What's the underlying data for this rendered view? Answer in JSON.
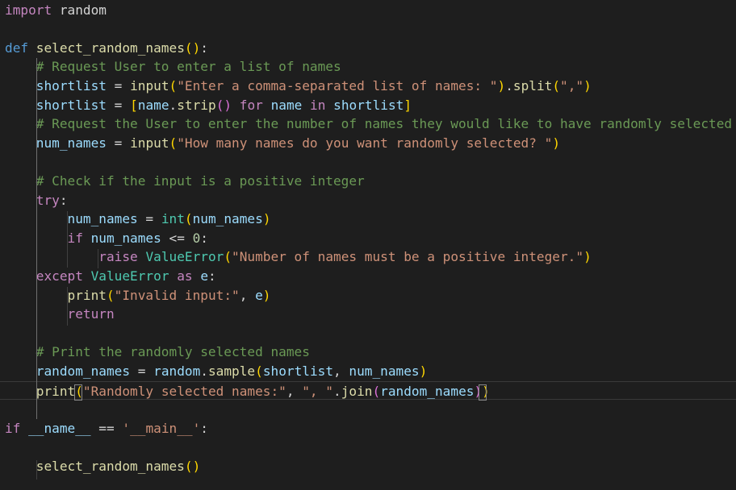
{
  "editor": {
    "language": "python",
    "colors": {
      "background": "#1e1e1e",
      "text": "#d4d4d4",
      "keyword": "#569cd6",
      "control": "#c586c0",
      "function": "#dcdcaa",
      "variable": "#9cdcfe",
      "string": "#ce9178",
      "comment": "#6a9955",
      "number": "#b5cea8",
      "class": "#4ec9b0",
      "bracket_1": "#ffd700",
      "bracket_2": "#da70d6",
      "bracket_3": "#179fff"
    },
    "lines": [
      [
        {
          "t": "import",
          "c": "control"
        },
        {
          "t": " random",
          "c": "text"
        }
      ],
      [],
      [
        {
          "t": "def",
          "c": "keyword"
        },
        {
          "t": " ",
          "c": "text"
        },
        {
          "t": "select_random_names",
          "c": "function"
        },
        {
          "t": "(",
          "c": "bracket_1"
        },
        {
          "t": ")",
          "c": "bracket_1"
        },
        {
          "t": ":",
          "c": "text"
        }
      ],
      [
        {
          "t": "    ",
          "c": "text"
        },
        {
          "t": "# Request User to enter a list of names",
          "c": "comment"
        }
      ],
      [
        {
          "t": "    ",
          "c": "text"
        },
        {
          "t": "shortlist",
          "c": "variable"
        },
        {
          "t": " = ",
          "c": "text"
        },
        {
          "t": "input",
          "c": "function"
        },
        {
          "t": "(",
          "c": "bracket_1"
        },
        {
          "t": "\"Enter a comma-separated list of names: \"",
          "c": "string"
        },
        {
          "t": ")",
          "c": "bracket_1"
        },
        {
          "t": ".",
          "c": "text"
        },
        {
          "t": "split",
          "c": "function"
        },
        {
          "t": "(",
          "c": "bracket_1"
        },
        {
          "t": "\",\"",
          "c": "string"
        },
        {
          "t": ")",
          "c": "bracket_1"
        }
      ],
      [
        {
          "t": "    ",
          "c": "text"
        },
        {
          "t": "shortlist",
          "c": "variable"
        },
        {
          "t": " = ",
          "c": "text"
        },
        {
          "t": "[",
          "c": "bracket_1"
        },
        {
          "t": "name",
          "c": "variable"
        },
        {
          "t": ".",
          "c": "text"
        },
        {
          "t": "strip",
          "c": "function"
        },
        {
          "t": "(",
          "c": "bracket_2"
        },
        {
          "t": ")",
          "c": "bracket_2"
        },
        {
          "t": " ",
          "c": "text"
        },
        {
          "t": "for",
          "c": "control"
        },
        {
          "t": " ",
          "c": "text"
        },
        {
          "t": "name",
          "c": "variable"
        },
        {
          "t": " ",
          "c": "text"
        },
        {
          "t": "in",
          "c": "control"
        },
        {
          "t": " ",
          "c": "text"
        },
        {
          "t": "shortlist",
          "c": "variable"
        },
        {
          "t": "]",
          "c": "bracket_1"
        }
      ],
      [
        {
          "t": "    ",
          "c": "text"
        },
        {
          "t": "# Request the User to enter the number of names they would like to have randomly selected",
          "c": "comment"
        }
      ],
      [
        {
          "t": "    ",
          "c": "text"
        },
        {
          "t": "num_names",
          "c": "variable"
        },
        {
          "t": " = ",
          "c": "text"
        },
        {
          "t": "input",
          "c": "function"
        },
        {
          "t": "(",
          "c": "bracket_1"
        },
        {
          "t": "\"How many names do you want randomly selected? \"",
          "c": "string"
        },
        {
          "t": ")",
          "c": "bracket_1"
        }
      ],
      [],
      [
        {
          "t": "    ",
          "c": "text"
        },
        {
          "t": "# Check if the input is a positive integer",
          "c": "comment"
        }
      ],
      [
        {
          "t": "    ",
          "c": "text"
        },
        {
          "t": "try",
          "c": "control"
        },
        {
          "t": ":",
          "c": "text"
        }
      ],
      [
        {
          "t": "        ",
          "c": "text"
        },
        {
          "t": "num_names",
          "c": "variable"
        },
        {
          "t": " = ",
          "c": "text"
        },
        {
          "t": "int",
          "c": "class"
        },
        {
          "t": "(",
          "c": "bracket_1"
        },
        {
          "t": "num_names",
          "c": "variable"
        },
        {
          "t": ")",
          "c": "bracket_1"
        }
      ],
      [
        {
          "t": "        ",
          "c": "text"
        },
        {
          "t": "if",
          "c": "control"
        },
        {
          "t": " ",
          "c": "text"
        },
        {
          "t": "num_names",
          "c": "variable"
        },
        {
          "t": " <= ",
          "c": "text"
        },
        {
          "t": "0",
          "c": "number"
        },
        {
          "t": ":",
          "c": "text"
        }
      ],
      [
        {
          "t": "            ",
          "c": "text"
        },
        {
          "t": "raise",
          "c": "control"
        },
        {
          "t": " ",
          "c": "text"
        },
        {
          "t": "ValueError",
          "c": "class"
        },
        {
          "t": "(",
          "c": "bracket_1"
        },
        {
          "t": "\"Number of names must be a positive integer.\"",
          "c": "string"
        },
        {
          "t": ")",
          "c": "bracket_1"
        }
      ],
      [
        {
          "t": "    ",
          "c": "text"
        },
        {
          "t": "except",
          "c": "control"
        },
        {
          "t": " ",
          "c": "text"
        },
        {
          "t": "ValueError",
          "c": "class"
        },
        {
          "t": " ",
          "c": "text"
        },
        {
          "t": "as",
          "c": "control"
        },
        {
          "t": " ",
          "c": "text"
        },
        {
          "t": "e",
          "c": "variable"
        },
        {
          "t": ":",
          "c": "text"
        }
      ],
      [
        {
          "t": "        ",
          "c": "text"
        },
        {
          "t": "print",
          "c": "function"
        },
        {
          "t": "(",
          "c": "bracket_1"
        },
        {
          "t": "\"Invalid input:\"",
          "c": "string"
        },
        {
          "t": ", ",
          "c": "text"
        },
        {
          "t": "e",
          "c": "variable"
        },
        {
          "t": ")",
          "c": "bracket_1"
        }
      ],
      [
        {
          "t": "        ",
          "c": "text"
        },
        {
          "t": "return",
          "c": "control"
        }
      ],
      [],
      [
        {
          "t": "    ",
          "c": "text"
        },
        {
          "t": "# Print the randomly selected names",
          "c": "comment"
        }
      ],
      [
        {
          "t": "    ",
          "c": "text"
        },
        {
          "t": "random_names",
          "c": "variable"
        },
        {
          "t": " = ",
          "c": "text"
        },
        {
          "t": "random",
          "c": "variable"
        },
        {
          "t": ".",
          "c": "text"
        },
        {
          "t": "sample",
          "c": "function"
        },
        {
          "t": "(",
          "c": "bracket_1"
        },
        {
          "t": "shortlist",
          "c": "variable"
        },
        {
          "t": ", ",
          "c": "text"
        },
        {
          "t": "num_names",
          "c": "variable"
        },
        {
          "t": ")",
          "c": "bracket_1"
        }
      ],
      [
        {
          "t": "    ",
          "c": "text"
        },
        {
          "t": "print",
          "c": "function"
        },
        {
          "t": "(",
          "c": "bracket_1"
        },
        {
          "t": "\"Randomly selected names:\"",
          "c": "string"
        },
        {
          "t": ", ",
          "c": "text"
        },
        {
          "t": "\", \"",
          "c": "string"
        },
        {
          "t": ".",
          "c": "text"
        },
        {
          "t": "join",
          "c": "function"
        },
        {
          "t": "(",
          "c": "bracket_2"
        },
        {
          "t": "random_names",
          "c": "variable"
        },
        {
          "t": ")",
          "c": "bracket_2"
        },
        {
          "t": ")",
          "c": "bracket_1"
        }
      ],
      [],
      [
        {
          "t": "if",
          "c": "control"
        },
        {
          "t": " ",
          "c": "text"
        },
        {
          "t": "__name__",
          "c": "variable"
        },
        {
          "t": " == ",
          "c": "text"
        },
        {
          "t": "'__main__'",
          "c": "string"
        },
        {
          "t": ":",
          "c": "text"
        }
      ],
      [],
      [
        {
          "t": "    ",
          "c": "text"
        },
        {
          "t": "select_random_names",
          "c": "function"
        },
        {
          "t": "(",
          "c": "bracket_1"
        },
        {
          "t": ")",
          "c": "bracket_1"
        }
      ]
    ]
  }
}
